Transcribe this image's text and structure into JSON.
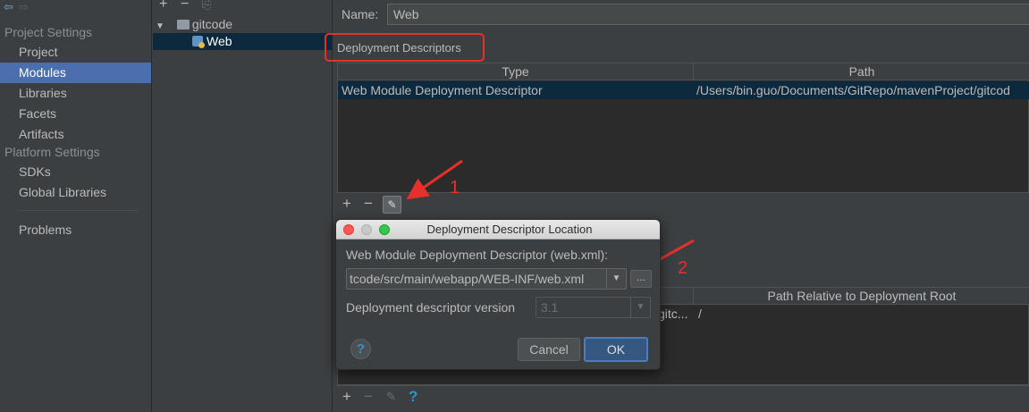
{
  "sidebar": {
    "project_settings_header": "Project Settings",
    "project_items": [
      "Project",
      "Modules",
      "Libraries",
      "Facets",
      "Artifacts"
    ],
    "platform_settings_header": "Platform Settings",
    "platform_items": [
      "SDKs",
      "Global Libraries"
    ],
    "problems": "Problems",
    "active_item": "Modules"
  },
  "tree": {
    "root": "gitcode",
    "child": "Web"
  },
  "module": {
    "name_label": "Name:",
    "name_value": "Web",
    "section_title": "Deployment Descriptors"
  },
  "descriptors_table": {
    "columns": [
      "Type",
      "Path"
    ],
    "rows": [
      [
        "Web Module Deployment Descriptor",
        "/Users/bin.guo/Documents/GitRepo/mavenProject/gitcod"
      ]
    ]
  },
  "resources_table": {
    "columns": [
      "Path Relative to Deployment Root"
    ],
    "partial_cell": "gitc...",
    "root_path": "/"
  },
  "annotations": {
    "marker_1": "1",
    "marker_2": "2"
  },
  "dialog": {
    "title": "Deployment Descriptor Location",
    "field_label": "Web Module Deployment Descriptor (web.xml):",
    "path_value": "tcode/src/main/webapp/WEB-INF/web.xml",
    "browse_label": "...",
    "version_label": "Deployment descriptor version",
    "version_value": "3.1",
    "help_label": "?",
    "cancel_label": "Cancel",
    "ok_label": "OK"
  },
  "colors": {
    "accent": "#4b6eaf",
    "selection": "#0d293e",
    "annotation_red": "#e8302a"
  }
}
